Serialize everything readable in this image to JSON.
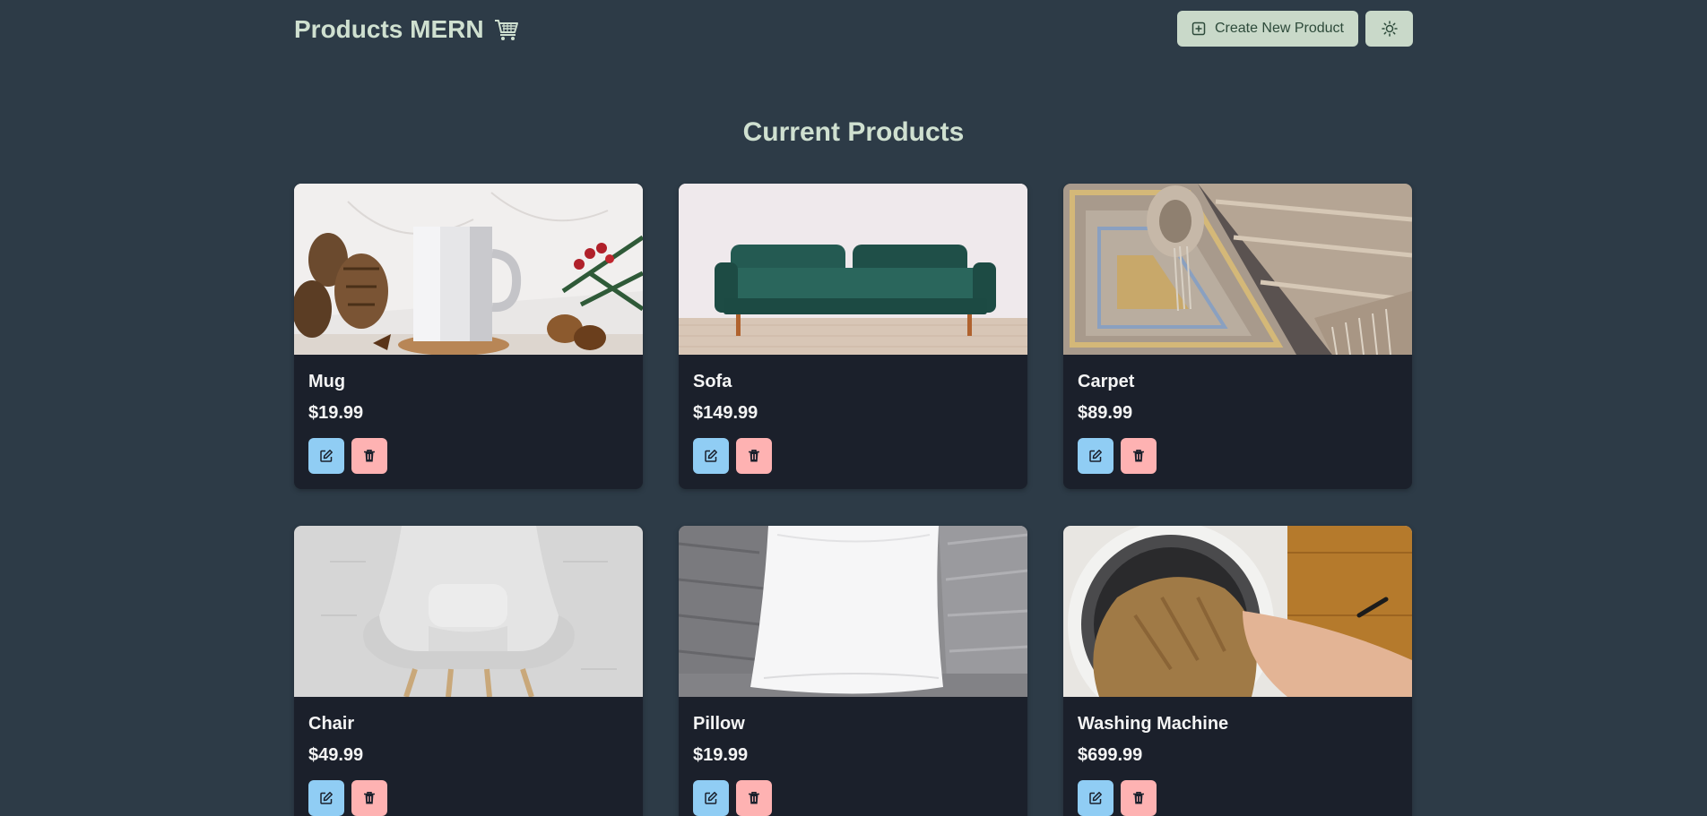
{
  "navbar": {
    "brand_title": "Products MERN",
    "brand_icon": "shopping-cart-icon",
    "create_label": "Create New Product",
    "create_icon": "plus-square-icon",
    "theme_icon": "sun-icon"
  },
  "main": {
    "heading": "Current Products"
  },
  "products": [
    {
      "name": "Mug",
      "price": "$19.99",
      "image": "mug-photo"
    },
    {
      "name": "Sofa",
      "price": "$149.99",
      "image": "sofa-photo"
    },
    {
      "name": "Carpet",
      "price": "$89.99",
      "image": "carpet-photo"
    },
    {
      "name": "Chair",
      "price": "$49.99",
      "image": "chair-photo"
    },
    {
      "name": "Pillow",
      "price": "$19.99",
      "image": "pillow-photo"
    },
    {
      "name": "Washing Machine",
      "price": "$699.99",
      "image": "washing-machine-photo"
    }
  ],
  "card_actions": {
    "edit_icon": "edit-icon",
    "delete_icon": "trash-icon"
  },
  "colors": {
    "page_bg": "#2d3b47",
    "card_bg": "#1b202b",
    "accent_button": "#c9d9c9",
    "edit_button": "#90cdf4",
    "delete_button": "#feb2b2"
  }
}
